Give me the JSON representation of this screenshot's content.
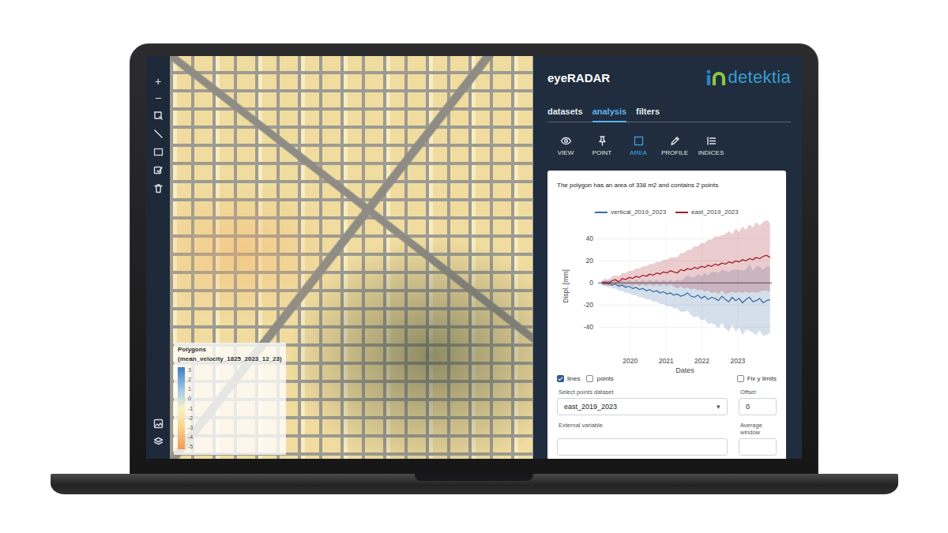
{
  "app": {
    "title": "eyeRADAR",
    "brand": "detektia"
  },
  "map_toolbar": {
    "zoom": [
      "+",
      "−"
    ]
  },
  "map_legend": {
    "title": "Polygons",
    "subtitle": "(mean_velocity_1825_2023_12_23)",
    "ticks": [
      "3",
      "2",
      "1",
      "0",
      "-1",
      "-2",
      "-3",
      "-4",
      "-5"
    ]
  },
  "tabs": [
    {
      "label": "datasets",
      "selected": false
    },
    {
      "label": "analysis",
      "selected": true
    },
    {
      "label": "filters",
      "selected": false
    }
  ],
  "tools": [
    {
      "label": "VIEW",
      "selected": false
    },
    {
      "label": "POINT",
      "selected": false
    },
    {
      "label": "AREA",
      "selected": true
    },
    {
      "label": "PROFILE",
      "selected": false
    },
    {
      "label": "INDICES",
      "selected": false
    }
  ],
  "analysis": {
    "summary": "The polygon has an area of 338 m2 and contains 2 points",
    "chart": {
      "y_label": "Displ. [mm]",
      "x_label": "Dates",
      "y_ticks": [
        "40",
        "20",
        "0",
        "-20",
        "-40"
      ],
      "x_ticks": [
        "2020",
        "2021",
        "2022",
        "2023"
      ],
      "series": [
        {
          "name": "vertical_2019_2023",
          "color": "#3a6ea5",
          "values": [
            0,
            -1,
            1,
            -2,
            -1,
            -3,
            -2,
            -4,
            -3,
            -5,
            -4,
            -6,
            -5,
            -7,
            -6,
            -8,
            -7,
            -9,
            -8,
            -10,
            -9,
            -11,
            -10,
            -12,
            -11,
            -9,
            -12,
            -13,
            -11,
            -14,
            -12,
            -15,
            -13,
            -14,
            -16,
            -12,
            -15,
            -17,
            -13,
            -16,
            -14,
            -18,
            -15,
            -13,
            -17,
            -16,
            -14,
            -18,
            -16,
            -15
          ],
          "spread": [
            2,
            2,
            3,
            3,
            4,
            4,
            5,
            5,
            6,
            6,
            7,
            7,
            8,
            8,
            9,
            9,
            10,
            10,
            11,
            11,
            12,
            12,
            13,
            14,
            15,
            16,
            17,
            18,
            19,
            20,
            21,
            22,
            23,
            24,
            25,
            24,
            26,
            27,
            25,
            28,
            26,
            29,
            27,
            30,
            28,
            31,
            29,
            30,
            31,
            30
          ]
        },
        {
          "name": "east_2019_2023",
          "color": "#a31d24",
          "values": [
            0,
            1,
            -1,
            2,
            3,
            1,
            4,
            3,
            5,
            4,
            6,
            5,
            7,
            6,
            8,
            7,
            9,
            8,
            10,
            9,
            11,
            10,
            9,
            12,
            11,
            13,
            12,
            14,
            13,
            15,
            14,
            16,
            15,
            17,
            16,
            18,
            17,
            19,
            18,
            20,
            19,
            21,
            20,
            22,
            21,
            23,
            22,
            24,
            25,
            23
          ],
          "spread": [
            2,
            3,
            3,
            4,
            4,
            5,
            5,
            6,
            6,
            7,
            7,
            8,
            8,
            9,
            9,
            10,
            10,
            11,
            11,
            12,
            12,
            13,
            14,
            15,
            16,
            17,
            18,
            19,
            20,
            21,
            22,
            23,
            24,
            25,
            26,
            25,
            27,
            28,
            26,
            29,
            27,
            30,
            28,
            31,
            29,
            32,
            30,
            31,
            32,
            31
          ]
        }
      ]
    },
    "options": [
      {
        "label": "lines",
        "checked": true
      },
      {
        "label": "points",
        "checked": false
      },
      {
        "label": "Fix y limits",
        "checked": false
      }
    ],
    "dataset_select": {
      "label": "Select points dataset",
      "value": "east_2019_2023",
      "arrow": "▾"
    },
    "offset": {
      "label": "Offset",
      "value": "0"
    },
    "external_variable": {
      "label": "External variable"
    },
    "average_window": {
      "label": "Average window"
    }
  }
}
